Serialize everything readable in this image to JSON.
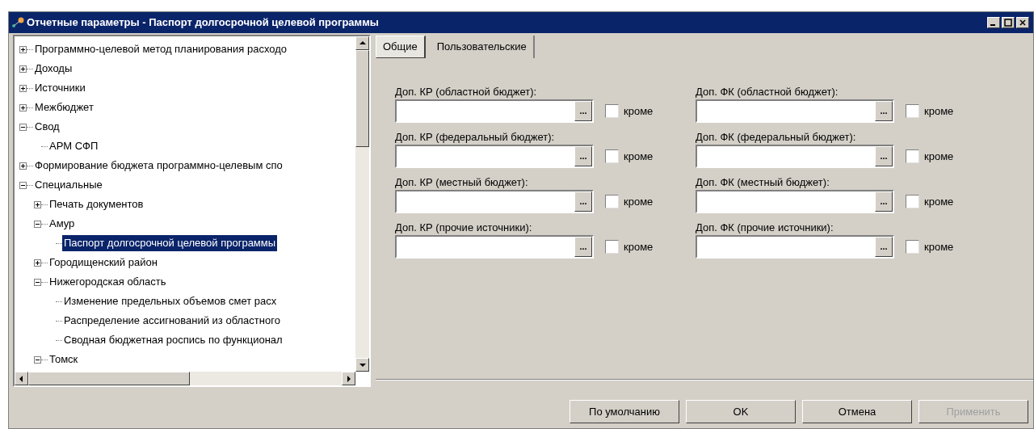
{
  "window": {
    "title": "Отчетные параметры - Паспорт долгосрочной целевой программы"
  },
  "tree": [
    {
      "label": "Программно-целевой метод планирования расходо",
      "expanded": false,
      "selected": false
    },
    {
      "label": "Доходы",
      "expanded": false,
      "selected": false
    },
    {
      "label": "Источники",
      "expanded": false,
      "selected": false
    },
    {
      "label": "Межбюджет",
      "expanded": false,
      "selected": false
    },
    {
      "label": "Свод",
      "expanded": true,
      "selected": false,
      "children": [
        {
          "label": "АРМ СФП",
          "selected": false
        }
      ]
    },
    {
      "label": "Формирование бюджета программно-целевым спо",
      "expanded": false,
      "selected": false
    },
    {
      "label": "Специальные",
      "expanded": true,
      "selected": false,
      "children": [
        {
          "label": "Печать документов",
          "expanded": false,
          "selected": false
        },
        {
          "label": "Амур",
          "expanded": true,
          "selected": false,
          "children": [
            {
              "label": "Паспорт долгосрочной целевой программы",
              "selected": true
            }
          ]
        },
        {
          "label": "Городищенский район",
          "expanded": false,
          "selected": false
        },
        {
          "label": "Нижегородская область",
          "expanded": true,
          "selected": false,
          "children": [
            {
              "label": "Изменение предельных объемов смет расх",
              "selected": false
            },
            {
              "label": "Распределение ассигнований из областного",
              "selected": false
            },
            {
              "label": "Сводная бюджетная роспись по функционал",
              "selected": false
            }
          ]
        },
        {
          "label": "Томск",
          "expanded": true,
          "selected": false
        }
      ]
    }
  ],
  "tabs": [
    {
      "label": "Общие",
      "selected": true
    },
    {
      "label": "Пользовательские",
      "selected": false
    }
  ],
  "fields": [
    {
      "label": "Доп. КР (областной бюджет):",
      "browse": "...",
      "except": {
        "label": "кроме",
        "checked": false
      }
    },
    {
      "label": "Доп. ФК (областной бюджет):",
      "browse": "...",
      "except": {
        "label": "кроме",
        "checked": false
      }
    },
    {
      "label": "Доп. КР (федеральный бюджет):",
      "browse": "...",
      "except": {
        "label": "кроме",
        "checked": false
      }
    },
    {
      "label": "Доп. ФК (федеральный бюджет):",
      "browse": "...",
      "except": {
        "label": "кроме",
        "checked": false
      }
    },
    {
      "label": "Доп. КР (местный бюджет):",
      "browse": "...",
      "except": {
        "label": "кроме",
        "checked": false
      }
    },
    {
      "label": "Доп. ФК (местный бюджет):",
      "browse": "...",
      "except": {
        "label": "кроме",
        "checked": false
      }
    },
    {
      "label": "Доп. КР (прочие источники):",
      "browse": "...",
      "except": {
        "label": "кроме",
        "checked": false
      }
    },
    {
      "label": "Доп. ФК (прочие источники):",
      "browse": "...",
      "except": {
        "label": "кроме",
        "checked": false
      }
    }
  ],
  "buttons": [
    {
      "label": "По умолчанию",
      "disabled": false
    },
    {
      "label": "OK",
      "disabled": false
    },
    {
      "label": "Отмена",
      "disabled": false
    },
    {
      "label": "Применить",
      "disabled": true
    }
  ]
}
